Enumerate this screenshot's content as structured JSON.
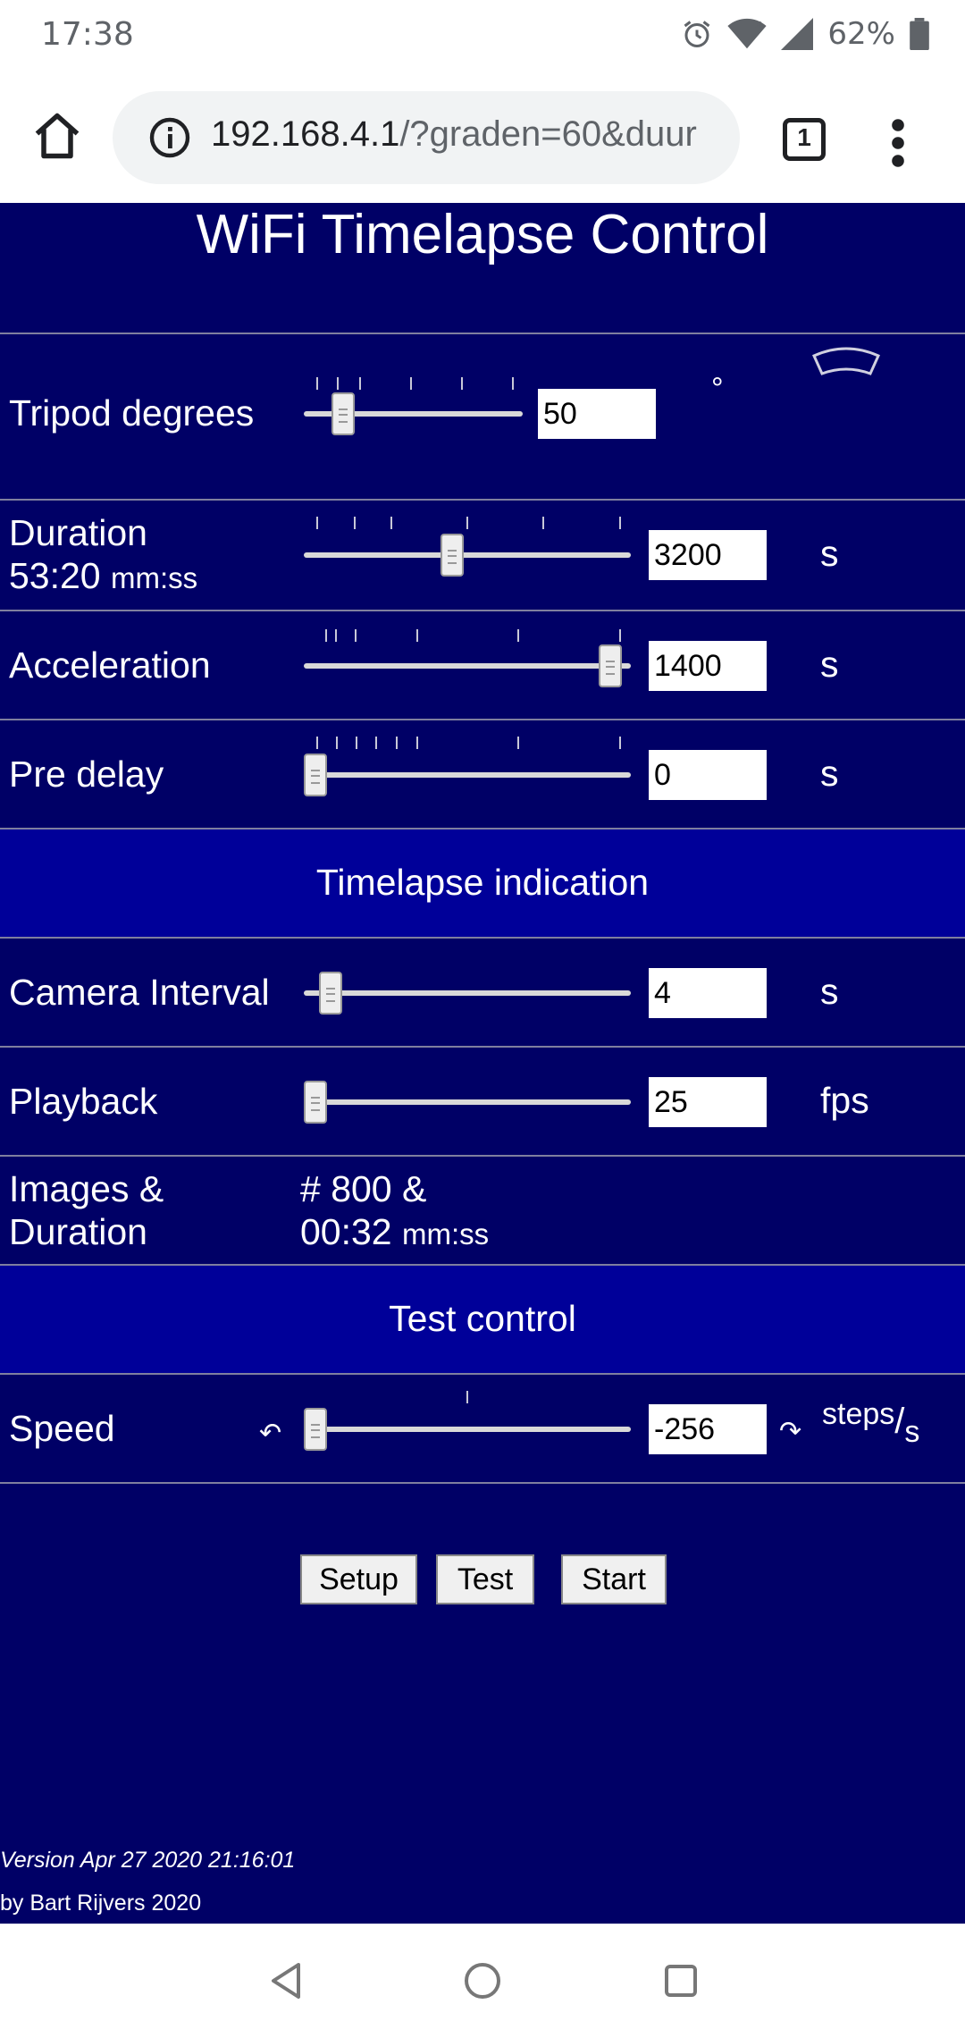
{
  "status_bar": {
    "time": "17:38",
    "battery": "62%"
  },
  "browser": {
    "url_host": "192.168.4.1",
    "url_rest": "/?graden=60&duur",
    "tab_count": "1"
  },
  "page": {
    "title": "WiFi Timelapse Control",
    "tripod": {
      "label": "Tripod degrees",
      "value": "50",
      "unit": "°",
      "slider": 0.14
    },
    "duration": {
      "label": "Duration",
      "sub_value": "53:20",
      "sub_unit": "mm:ss",
      "value": "3200",
      "unit": "s",
      "slider": 0.45
    },
    "acceleration": {
      "label": "Acceleration",
      "value": "1400",
      "unit": "s",
      "slider": 0.97
    },
    "predelay": {
      "label": "Pre delay",
      "value": "0",
      "unit": "s",
      "slider": 0.0
    },
    "timelapse_header": "Timelapse indication",
    "interval": {
      "label": "Camera Interval",
      "value": "4",
      "unit": "s",
      "slider": 0.05
    },
    "playback": {
      "label": "Playback",
      "value": "25",
      "unit": "fps",
      "slider": 0.0
    },
    "images": {
      "label_line1": "Images &",
      "label_line2": "Duration",
      "value_line1": "# 800 &",
      "value_line2": "00:32",
      "value_unit": "mm:ss"
    },
    "test_header": "Test control",
    "speed": {
      "label": "Speed",
      "value": "-256",
      "unit_top": "steps",
      "unit_slash": "/",
      "unit_bottom": "s",
      "slider": 0.0,
      "ccw_glyph": "↶",
      "cw_glyph": "↷"
    },
    "buttons": {
      "setup": "Setup",
      "test": "Test",
      "start": "Start"
    },
    "footer": {
      "version": "Version Apr 27 2020 21:16:01",
      "author": "by Bart Rijvers 2020"
    }
  }
}
